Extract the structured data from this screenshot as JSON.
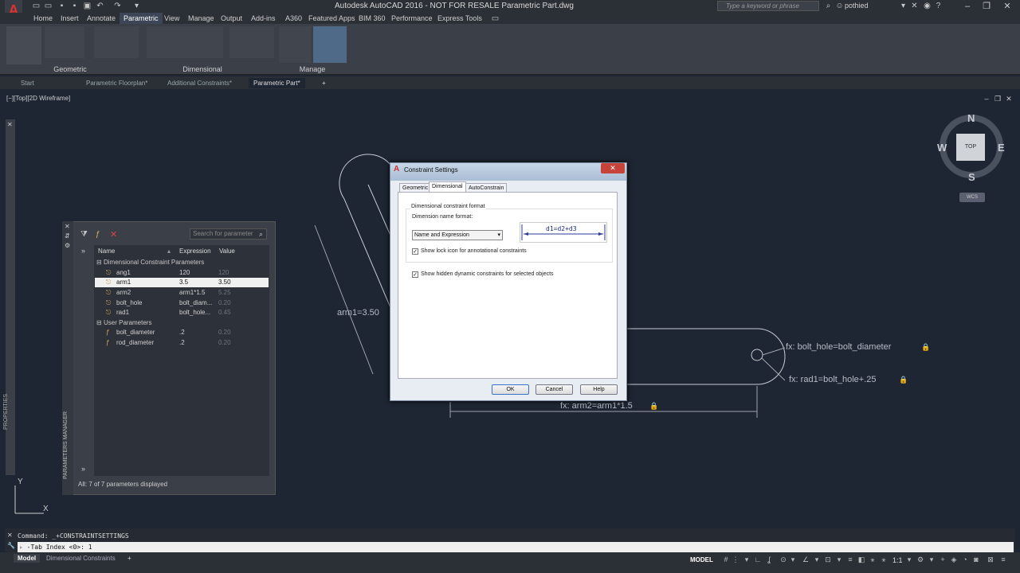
{
  "window": {
    "title": "Autodesk AutoCAD 2016 - NOT FOR RESALE    Parametric Part.dwg",
    "search_placeholder": "Type a keyword or phrase",
    "user": "pothied"
  },
  "ribbon": {
    "tabs": [
      "Home",
      "Insert",
      "Annotate",
      "Parametric",
      "View",
      "Manage",
      "Output",
      "Add-ins",
      "A360",
      "Featured Apps",
      "BIM 360",
      "Performance",
      "Express Tools"
    ],
    "active_tab": "Parametric",
    "groups": [
      "Geometric",
      "Dimensional",
      "Manage"
    ]
  },
  "doc_tabs": [
    "Start",
    "Parametric Floorplan*",
    "Additional Constraints*",
    "Parametric Part*"
  ],
  "active_doc_tab": "Parametric Part*",
  "viewport_label": "[−][Top][2D Wireframe]",
  "properties_label": "PROPERTIES",
  "parameters_manager": {
    "side_label": "PARAMETERS MANAGER",
    "search_placeholder": "Search for parameter",
    "columns": [
      "Name",
      "Expression",
      "Value"
    ],
    "group_dim": "Dimensional Constraint Parameters",
    "group_user": "User Parameters",
    "rows": [
      {
        "name": "ang1",
        "expr": "120",
        "value": "120"
      },
      {
        "name": "arm1",
        "expr": "3.5",
        "value": "3.50"
      },
      {
        "name": "arm2",
        "expr": "arm1*1.5",
        "value": "5.25"
      },
      {
        "name": "bolt_hole",
        "expr": "bolt_diam...",
        "value": "0.20"
      },
      {
        "name": "rad1",
        "expr": "bolt_hole...",
        "value": "0.45"
      }
    ],
    "user_rows": [
      {
        "name": "bolt_diameter",
        "expr": ".2",
        "value": "0.20"
      },
      {
        "name": "rod_diameter",
        "expr": ".2",
        "value": "0.20"
      }
    ],
    "status": "All: 7 of 7 parameters displayed"
  },
  "dialog": {
    "title": "Constraint Settings",
    "tabs": [
      "Geometric",
      "Dimensional",
      "AutoConstrain"
    ],
    "active_tab": "Dimensional",
    "group_label": "Dimensional constraint format",
    "name_format_label": "Dimension name format:",
    "name_format_value": "Name and Expression",
    "preview_text": "d1=d2+d3",
    "chk_lock": "Show lock icon for annotational constraints",
    "chk_hidden": "Show hidden dynamic constraints for selected objects",
    "ok": "OK",
    "cancel": "Cancel",
    "help": "Help"
  },
  "drawing": {
    "arm1": "arm1=3.50",
    "bolt_hole": "fx: bolt_hole=bolt_diameter",
    "rad1": "fx: rad1=bolt_hole+.25",
    "arm2": "fx: arm2=arm1*1.5"
  },
  "viewcube": {
    "top": "TOP",
    "n": "N",
    "s": "S",
    "e": "E",
    "w": "W",
    "wcs": "WCS"
  },
  "command": {
    "history": "Command: _+CONSTRAINTSETTINGS",
    "input": "-Tab Index <0>: 1"
  },
  "status": {
    "tabs": [
      "Model",
      "Dimensional Constraints"
    ],
    "active": "Model",
    "model": "MODEL",
    "scale": "1:1"
  }
}
